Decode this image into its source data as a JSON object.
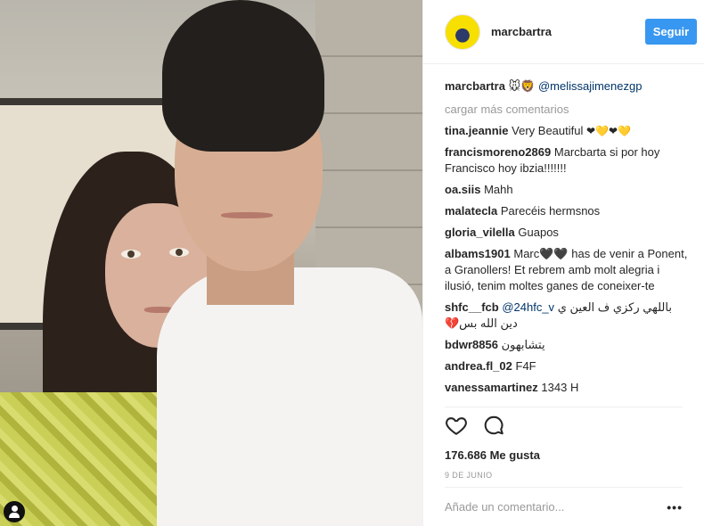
{
  "post": {
    "owner": "marcbartra",
    "follow_label": "Seguir",
    "caption": {
      "username": "marcbartra",
      "emoji": "🐭🦁",
      "mention": "@melissajimenezgp"
    },
    "load_more_label": "cargar más comentarios",
    "comments": [
      {
        "user": "tina.jeannie",
        "text": "Very Beautiful ",
        "emoji": "❤💛❤💛"
      },
      {
        "user": "francismoreno2869",
        "text": "Marcbarta si por hoy Francisco hoy ibzia!!!!!!!"
      },
      {
        "user": "oa.siis",
        "text": "Mahh"
      },
      {
        "user": "malatecla",
        "text": "Parecéis hermsnos"
      },
      {
        "user": "gloria_vilella",
        "text": "Guapos"
      },
      {
        "user": "albams1901",
        "text": "Marc🖤🖤 has de venir a Ponent, a Granollers! Et rebrem amb molt alegria i ilusió, tenim moltes ganes de coneixer-te"
      },
      {
        "user": "shfc__fcb",
        "mention": "@24hfc_v",
        "text": "باللهي ركزي ف العين ي دين الله بس💔"
      },
      {
        "user": "bdwr8856",
        "text": "يتشابهون"
      },
      {
        "user": "andrea.fl_02",
        "text": "F4F"
      },
      {
        "user": "vanessamartinez",
        "text": "1343 H"
      }
    ],
    "likes_label": "176.686 Me gusta",
    "date_label": "9 DE JUNIO",
    "comment_placeholder": "Añade un comentario...",
    "more_options": "•••",
    "icons": [
      "heart-icon",
      "comment-icon",
      "user-tag-icon",
      "more-options-icon"
    ],
    "colors": {
      "accent": "#3897f0",
      "mention": "#003569",
      "muted": "#999999",
      "heart": "#c00000"
    }
  }
}
